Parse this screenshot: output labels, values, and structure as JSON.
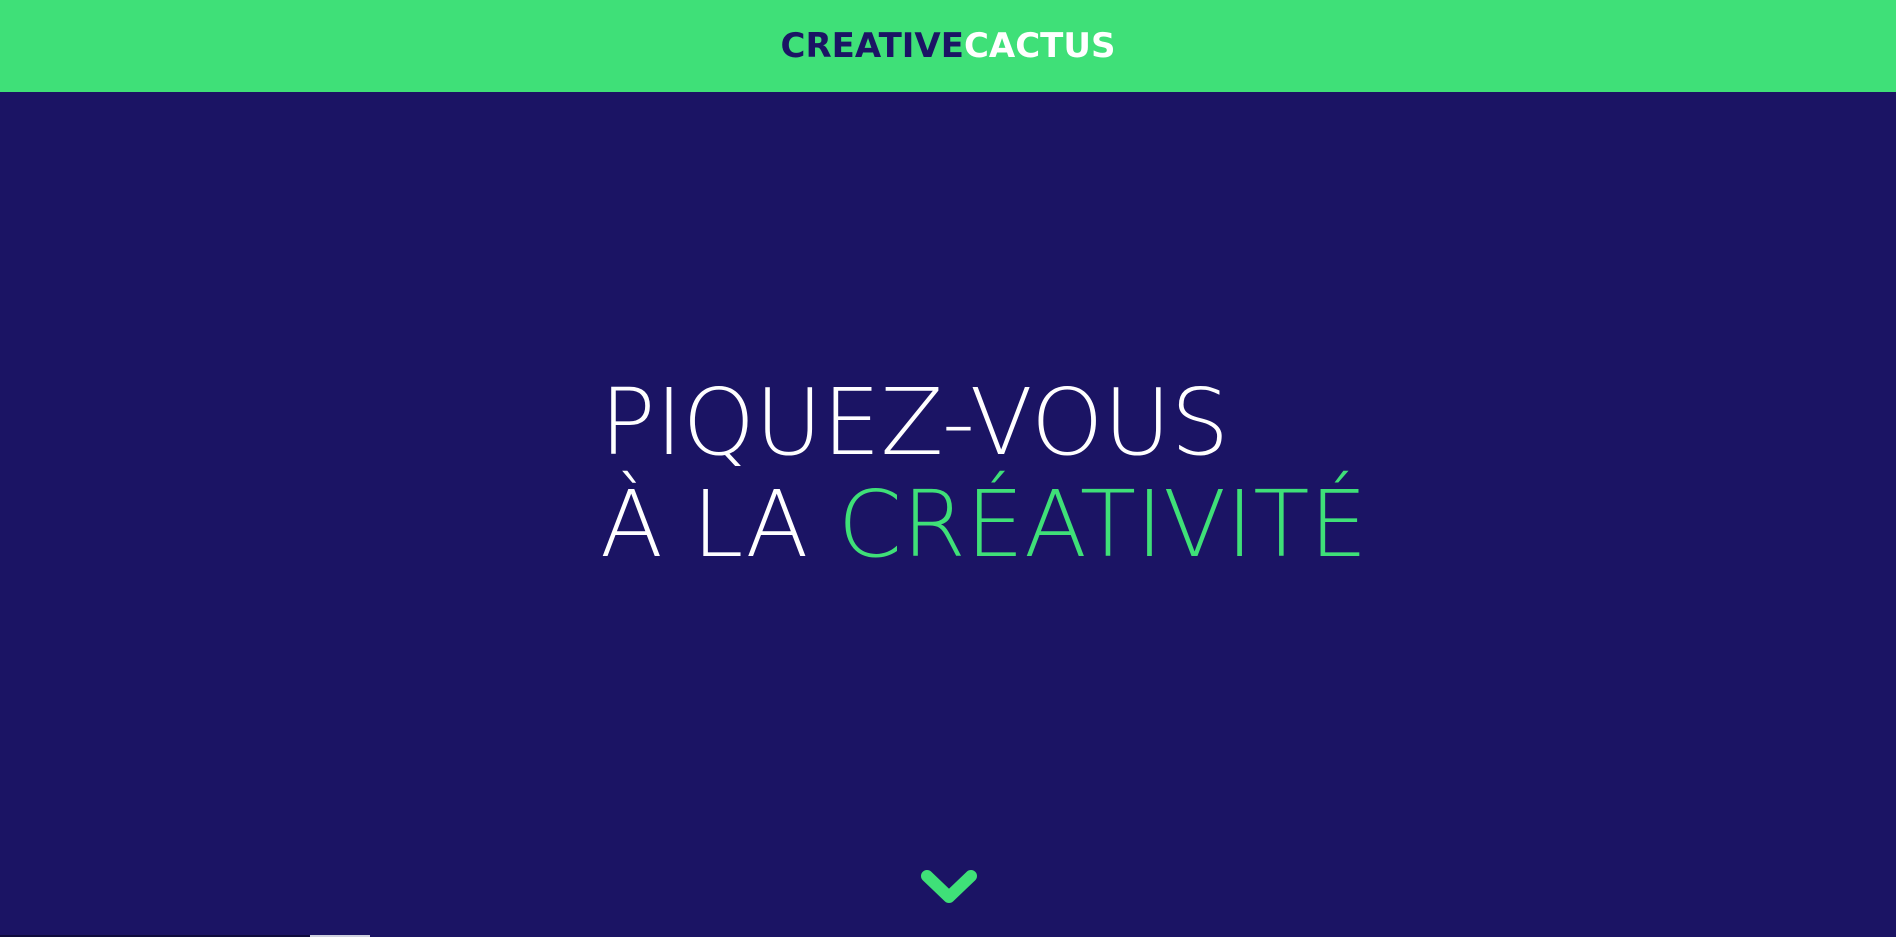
{
  "header": {
    "logo": {
      "part1": "CREATIVE",
      "part2": "CACTUS"
    },
    "background_color": "#3fe078"
  },
  "hero": {
    "background_color": "#1b1464",
    "headline": {
      "line1": "PIQUEZ-VOUS",
      "line2_prefix": "À LA ",
      "line2_accent": "CRÉATIVITÉ"
    },
    "accent_color": "#3fe078",
    "scroll_icon": "chevron-down-icon"
  }
}
